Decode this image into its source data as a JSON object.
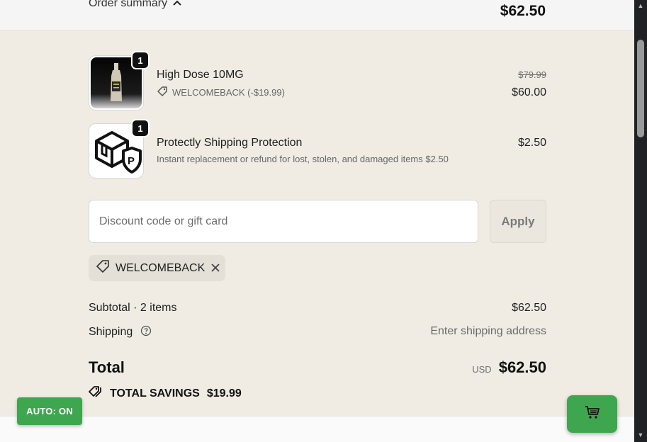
{
  "summary": {
    "toggle_label": "Order summary",
    "total": "$62.50"
  },
  "items": [
    {
      "quantity": "1",
      "name": "High Dose 10MG",
      "discount_code": "WELCOMEBACK (-$19.99)",
      "original_price": "$79.99",
      "price": "$60.00"
    },
    {
      "quantity": "1",
      "name": "Protectly Shipping Protection",
      "description": "Instant replacement or refund for lost, stolen, and damaged items $2.50",
      "price": "$2.50",
      "logo_letter": "P"
    }
  ],
  "discount": {
    "placeholder": "Discount code or gift card",
    "apply_label": "Apply",
    "applied_code": "WELCOMEBACK"
  },
  "totals": {
    "subtotal_label": "Subtotal · 2 items",
    "subtotal_value": "$62.50",
    "shipping_label": "Shipping",
    "shipping_value": "Enter shipping address",
    "total_label": "Total",
    "currency": "USD",
    "total_value": "$62.50",
    "savings_label": "TOTAL SAVINGS",
    "savings_value": "$19.99"
  },
  "widgets": {
    "auto_label": "AUTO: ON",
    "cart_icon": "cart-icon"
  },
  "colors": {
    "page_bg": "#f0ece4",
    "accent_green": "#3ea64f",
    "badge_black": "#111111"
  }
}
